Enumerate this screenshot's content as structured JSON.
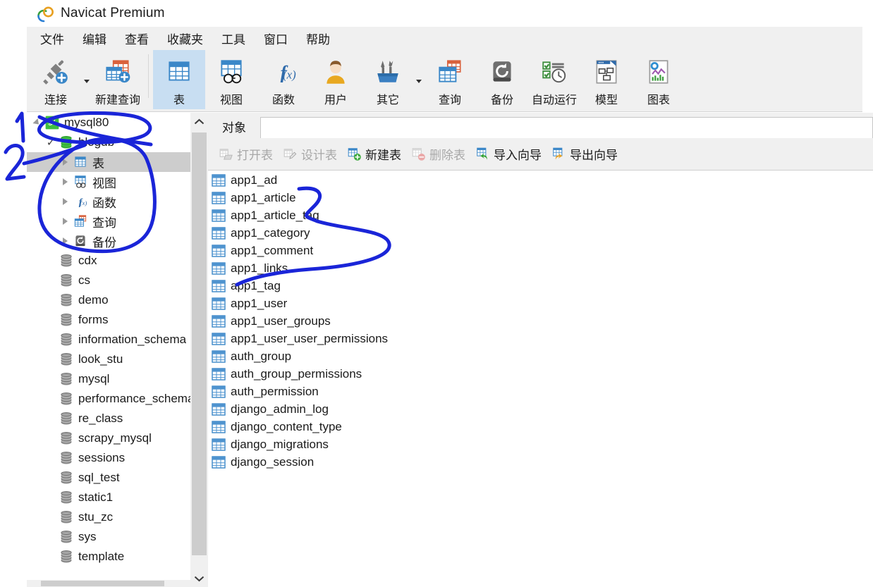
{
  "window": {
    "title": "Navicat Premium",
    "logo_icon": "navicat-logo-icon"
  },
  "menubar": {
    "items": [
      {
        "label": "文件",
        "name": "menu-file"
      },
      {
        "label": "编辑",
        "name": "menu-edit"
      },
      {
        "label": "查看",
        "name": "menu-view"
      },
      {
        "label": "收藏夹",
        "name": "menu-favorites"
      },
      {
        "label": "工具",
        "name": "menu-tools"
      },
      {
        "label": "窗口",
        "name": "menu-window"
      },
      {
        "label": "帮助",
        "name": "menu-help"
      }
    ]
  },
  "ribbon": {
    "buttons": [
      {
        "label": "连接",
        "icon": "connection-icon",
        "name": "ribbon-connection",
        "selected": false,
        "caret": true
      },
      {
        "label": "新建查询",
        "icon": "new-query-icon",
        "name": "ribbon-new-query",
        "selected": false,
        "caret": false
      },
      {
        "label": "表",
        "icon": "table-icon",
        "name": "ribbon-table",
        "selected": true,
        "caret": false
      },
      {
        "label": "视图",
        "icon": "view-icon",
        "name": "ribbon-view",
        "selected": false,
        "caret": false
      },
      {
        "label": "函数",
        "icon": "function-fx-icon",
        "name": "ribbon-function",
        "selected": false,
        "caret": false
      },
      {
        "label": "用户",
        "icon": "user-icon",
        "name": "ribbon-user",
        "selected": false,
        "caret": false
      },
      {
        "label": "其它",
        "icon": "other-tools-icon",
        "name": "ribbon-other",
        "selected": false,
        "caret": true
      },
      {
        "label": "查询",
        "icon": "query-icon",
        "name": "ribbon-query",
        "selected": false,
        "caret": false
      },
      {
        "label": "备份",
        "icon": "backup-icon",
        "name": "ribbon-backup",
        "selected": false,
        "caret": false
      },
      {
        "label": "自动运行",
        "icon": "automation-icon",
        "name": "ribbon-automation",
        "selected": false,
        "caret": false
      },
      {
        "label": "模型",
        "icon": "model-icon",
        "name": "ribbon-model",
        "selected": false,
        "caret": false
      },
      {
        "label": "图表",
        "icon": "chart-icon",
        "name": "ribbon-chart",
        "selected": false,
        "caret": false
      }
    ]
  },
  "sidebar": {
    "items": [
      {
        "label": "mysql80",
        "icon": "mysql-connection-icon",
        "depth": 0,
        "twisty": "expanded",
        "selected": false
      },
      {
        "label": "blogdb",
        "icon": "database-green-icon",
        "depth": 1,
        "twisty": "check",
        "selected": false
      },
      {
        "label": "表",
        "icon": "table-blue-icon",
        "depth": 2,
        "twisty": "collapsed",
        "selected": true
      },
      {
        "label": "视图",
        "icon": "view-blue-icon",
        "depth": 2,
        "twisty": "collapsed",
        "selected": false
      },
      {
        "label": "函数",
        "icon": "function-fx-icon",
        "depth": 2,
        "twisty": "collapsed",
        "selected": false
      },
      {
        "label": "查询",
        "icon": "query-icon",
        "depth": 2,
        "twisty": "collapsed",
        "selected": false
      },
      {
        "label": "备份",
        "icon": "backup-icon",
        "depth": 2,
        "twisty": "collapsed",
        "selected": false
      },
      {
        "label": "cdx",
        "icon": "database-gray-icon",
        "depth": 1,
        "twisty": "none",
        "selected": false
      },
      {
        "label": "cs",
        "icon": "database-gray-icon",
        "depth": 1,
        "twisty": "none",
        "selected": false
      },
      {
        "label": "demo",
        "icon": "database-gray-icon",
        "depth": 1,
        "twisty": "none",
        "selected": false
      },
      {
        "label": "forms",
        "icon": "database-gray-icon",
        "depth": 1,
        "twisty": "none",
        "selected": false
      },
      {
        "label": "information_schema",
        "icon": "database-gray-icon",
        "depth": 1,
        "twisty": "none",
        "selected": false
      },
      {
        "label": "look_stu",
        "icon": "database-gray-icon",
        "depth": 1,
        "twisty": "none",
        "selected": false
      },
      {
        "label": "mysql",
        "icon": "database-gray-icon",
        "depth": 1,
        "twisty": "none",
        "selected": false
      },
      {
        "label": "performance_schema",
        "icon": "database-gray-icon",
        "depth": 1,
        "twisty": "none",
        "selected": false
      },
      {
        "label": "re_class",
        "icon": "database-gray-icon",
        "depth": 1,
        "twisty": "none",
        "selected": false
      },
      {
        "label": "scrapy_mysql",
        "icon": "database-gray-icon",
        "depth": 1,
        "twisty": "none",
        "selected": false
      },
      {
        "label": "sessions",
        "icon": "database-gray-icon",
        "depth": 1,
        "twisty": "none",
        "selected": false
      },
      {
        "label": "sql_test",
        "icon": "database-gray-icon",
        "depth": 1,
        "twisty": "none",
        "selected": false
      },
      {
        "label": "static1",
        "icon": "database-gray-icon",
        "depth": 1,
        "twisty": "none",
        "selected": false
      },
      {
        "label": "stu_zc",
        "icon": "database-gray-icon",
        "depth": 1,
        "twisty": "none",
        "selected": false
      },
      {
        "label": "sys",
        "icon": "database-gray-icon",
        "depth": 1,
        "twisty": "none",
        "selected": false
      },
      {
        "label": "template",
        "icon": "database-gray-icon",
        "depth": 1,
        "twisty": "none",
        "selected": false
      }
    ],
    "scroll_up_icon": "chevron-up-icon",
    "scroll_down_icon": "chevron-down-icon"
  },
  "main": {
    "tab": {
      "label": "对象",
      "name": "tab-objects"
    },
    "toolbar": [
      {
        "label": "打开表",
        "icon": "open-table-icon",
        "name": "open-table-button",
        "enabled": false
      },
      {
        "label": "设计表",
        "icon": "design-table-icon",
        "name": "design-table-button",
        "enabled": false
      },
      {
        "label": "新建表",
        "icon": "new-table-icon",
        "name": "new-table-button",
        "enabled": true
      },
      {
        "label": "删除表",
        "icon": "delete-table-icon",
        "name": "delete-table-button",
        "enabled": false
      },
      {
        "label": "导入向导",
        "icon": "import-wizard-icon",
        "name": "import-wizard-button",
        "enabled": true
      },
      {
        "label": "导出向导",
        "icon": "export-wizard-icon",
        "name": "export-wizard-button",
        "enabled": true
      }
    ],
    "tables": [
      "app1_ad",
      "app1_article",
      "app1_article_tag",
      "app1_category",
      "app1_comment",
      "app1_links",
      "app1_tag",
      "app1_user",
      "app1_user_groups",
      "app1_user_user_permissions",
      "auth_group",
      "auth_group_permissions",
      "auth_permission",
      "django_admin_log",
      "django_content_type",
      "django_migrations",
      "django_session"
    ],
    "table_icon": "table-blue-icon"
  },
  "annotations": {
    "ink_color": "#1a25d8",
    "marks": [
      {
        "label": "1",
        "name": "annotation-number-1"
      },
      {
        "label": "2",
        "name": "annotation-number-2"
      },
      {
        "label": "",
        "name": "annotation-ellipse-mysql80"
      },
      {
        "label": "",
        "name": "annotation-ellipse-blogdb-children"
      },
      {
        "label": "",
        "name": "annotation-brace-app1-tables"
      }
    ]
  },
  "colors": {
    "chrome": "#f0f0f0",
    "selection_blue": "#c8def2",
    "tree_selection": "#cdcdcd",
    "accent_blue": "#3a7fc1",
    "ink": "#1a25d8"
  }
}
